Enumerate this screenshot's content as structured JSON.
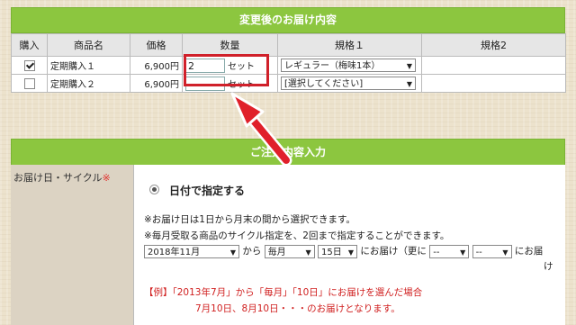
{
  "change_section": {
    "title": "変更後のお届け内容",
    "columns": [
      "購入",
      "商品名",
      "価格",
      "数量",
      "規格１",
      "規格2"
    ],
    "rows": [
      {
        "checked": true,
        "product": "定期購入１",
        "price": "6,900円",
        "qty": "2",
        "unit": "セット",
        "spec1": "レギュラー（梅味1本）",
        "spec2": ""
      },
      {
        "checked": false,
        "product": "定期購入２",
        "price": "6,900円",
        "qty": "",
        "unit": "セット",
        "spec1": "[選択してください]",
        "spec2": ""
      }
    ]
  },
  "order_section": {
    "title": "ご注文内容入力",
    "delivery_label": "お届け日・サイクル",
    "required_mark": "※",
    "radio_label": "日付で指定する",
    "note1": "※お届け日は1日から月末の間から選択できます。",
    "note2": "※毎月受取る商品のサイクル指定を、2回まで指定することができます。",
    "month_select": "2018年11月",
    "text_from": "から",
    "cycle_select": "毎月",
    "day_select": "15日",
    "text_deliver": "にお届け（更に",
    "extra_select1": "--",
    "extra_select2": "--",
    "text_deliver2": "にお届",
    "text_deliver3": "け",
    "example1": "【例】「2013年7月」から「毎月」「10日」にお届けを選んだ場合",
    "example2": "7月10日、8月10日・・・のお届けとなります。"
  },
  "colors": {
    "header_green": "#8cc63f",
    "highlight_red": "#d0202a",
    "arrow_red": "#e0202a"
  }
}
